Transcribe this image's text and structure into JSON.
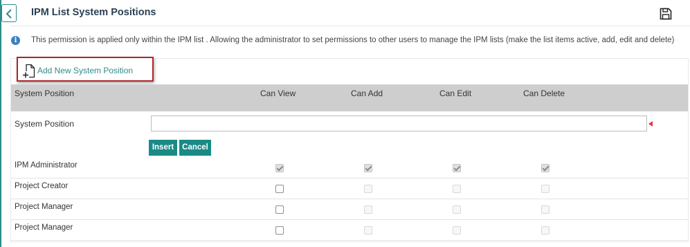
{
  "header": {
    "title": "IPM List System Positions"
  },
  "info": {
    "text": "This permission is applied only within the IPM list . Allowing the administrator to set permissions to other users to manage the IPM lists (make the list items active, add, edit and delete)"
  },
  "toolbar": {
    "add_label": "Add New System Position"
  },
  "table": {
    "columns": [
      "System Position",
      "Can View",
      "Can Add",
      "Can Edit",
      "Can Delete"
    ]
  },
  "form": {
    "label": "System Position",
    "value": "",
    "insert_label": "Insert",
    "cancel_label": "Cancel"
  },
  "rows": [
    {
      "name": "IPM Administrator",
      "can_view": true,
      "can_add": true,
      "can_edit": true,
      "can_delete": true,
      "editable": false
    },
    {
      "name": "Project Creator",
      "can_view": false,
      "can_add": false,
      "can_edit": false,
      "can_delete": false,
      "editable": true
    },
    {
      "name": "Project Manager",
      "can_view": false,
      "can_add": false,
      "can_edit": false,
      "can_delete": false,
      "editable": true
    },
    {
      "name": "Project Manager",
      "can_view": false,
      "can_add": false,
      "can_edit": false,
      "can_delete": false,
      "editable": true
    }
  ],
  "colors": {
    "accent": "#1a8a86",
    "title": "#2a3f54",
    "header_bg": "#cecece",
    "highlight_border": "#b0252b",
    "required": "#e03a3a",
    "info_icon": "#3a7fc1"
  },
  "icons": {
    "back": "chevron-left-icon",
    "save": "floppy-disk-icon",
    "info": "info-icon",
    "add": "add-document-icon"
  }
}
